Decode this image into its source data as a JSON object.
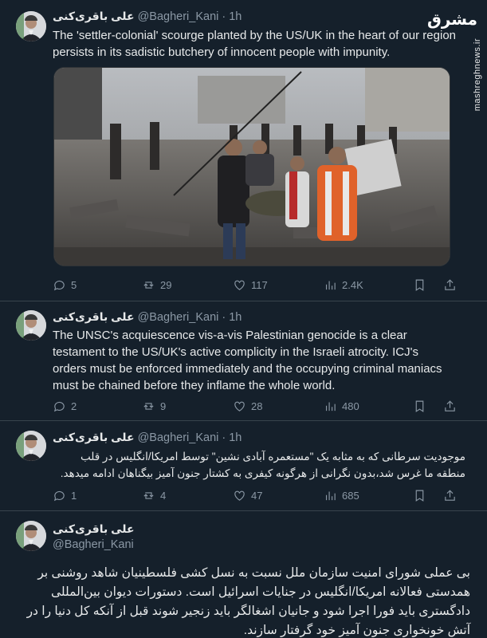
{
  "watermark": {
    "logo": "مشرق",
    "url": "mashreghnews.ir"
  },
  "tweets": [
    {
      "name": "علی باقری‌کنی",
      "handle": "@Bagheri_Kani",
      "dot": "·",
      "time": "1h",
      "text": "The 'settler-colonial' scourge planted by the US/UK  in the heart of our region persists in its sadistic butchery of innocent people with impunity.",
      "stats": {
        "replies": "5",
        "reposts": "29",
        "likes": "117",
        "views": "2.4K"
      }
    },
    {
      "name": "علی باقری‌کنی",
      "handle": "@Bagheri_Kani",
      "dot": "·",
      "time": "1h",
      "text": "The UNSC's acquiescence vis-a-vis Palestinian genocide is a clear testament to the US/UK's active complicity in the Israeli atrocity. ICJ's orders must be enforced immediately and the occupying criminal maniacs must be chained before they inflame the whole world.",
      "stats": {
        "replies": "2",
        "reposts": "9",
        "likes": "28",
        "views": "480"
      }
    },
    {
      "name": "علی باقری‌کنی",
      "handle": "@Bagheri_Kani",
      "dot": "·",
      "time": "1h",
      "text": "موجودیت سرطانی که به مثابه یک \"مستعمره آبادی نشین\" توسط امریکا/انگلیس در قلب منطقه ما غرس شد،بدون نگرانی از هرگونه کیفری به کشتار جنون آمیز بیگناهان ادامه میدهد.",
      "stats": {
        "replies": "1",
        "reposts": "4",
        "likes": "47",
        "views": "685"
      }
    },
    {
      "name": "علی باقری‌کنی",
      "handle": "@Bagheri_Kani",
      "text": "بی عملی شورای امنیت سازمان ملل نسبت به نسل کشی فلسطینیان شاهد روشنی بر همدستی فعالانه امریکا/انگلیس در جنایات اسرائیل است. دستورات دیوان بین‌المللی دادگستری باید فورا اجرا شود و جانیان اشغالگر باید زنجیر شوند قبل از آنکه کل دنیا را در آتش خونخواری جنون آمیز خود گرفتار سازند."
    }
  ]
}
